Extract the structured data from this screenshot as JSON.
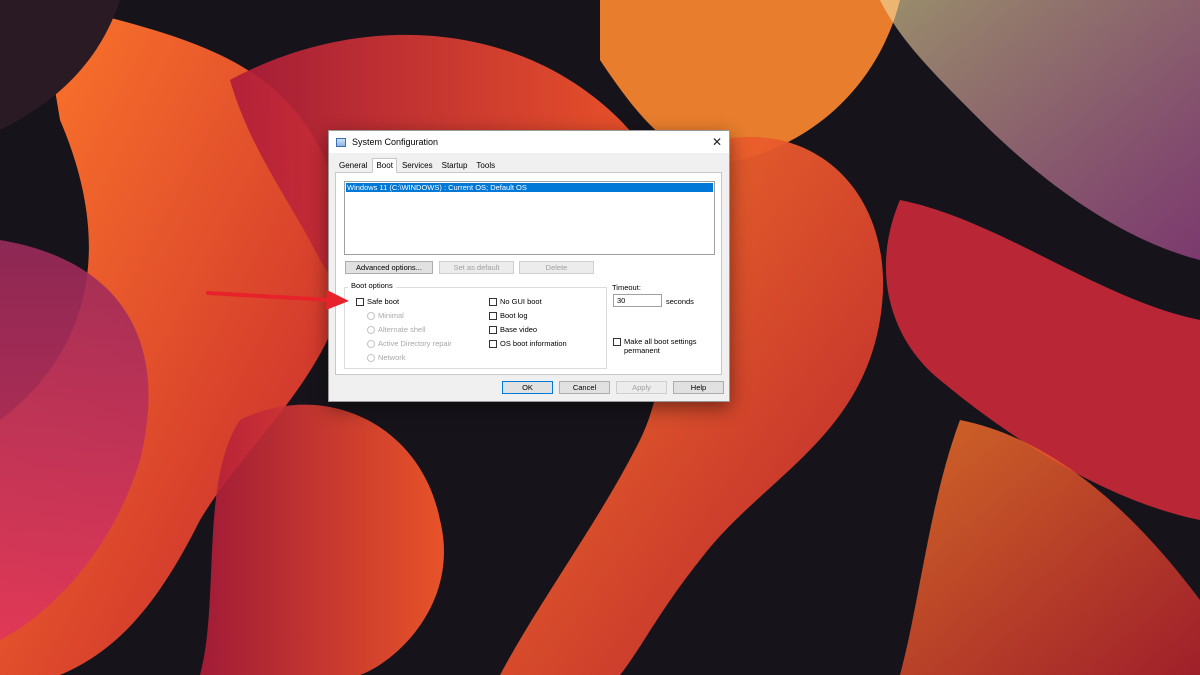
{
  "dialog": {
    "title": "System Configuration",
    "close_glyph": "✕",
    "icon": "system-config-icon"
  },
  "tabs": [
    {
      "label": "General",
      "active": false
    },
    {
      "label": "Boot",
      "active": true
    },
    {
      "label": "Services",
      "active": false
    },
    {
      "label": "Startup",
      "active": false
    },
    {
      "label": "Tools",
      "active": false
    }
  ],
  "boot": {
    "os_entries": [
      "Windows 11 (C:\\WINDOWS) : Current OS; Default OS"
    ],
    "advanced_label": "Advanced options...",
    "set_default_label": "Set as default",
    "delete_label": "Delete",
    "boot_options_label": "Boot options",
    "safe_boot_label": "Safe boot",
    "safe_boot_checked": false,
    "minimal_label": "Minimal",
    "alternate_shell_label": "Alternate shell",
    "active_directory_label": "Active Directory repair",
    "network_label": "Network",
    "no_gui_label": "No GUI boot",
    "boot_log_label": "Boot log",
    "base_video_label": "Base video",
    "os_boot_info_label": "OS boot information",
    "timeout_label": "Timeout:",
    "timeout_value": "30",
    "seconds_label": "seconds",
    "permanent_line1": "Make all boot settings",
    "permanent_line2": "permanent"
  },
  "footer": {
    "ok_label": "OK",
    "cancel_label": "Cancel",
    "apply_label": "Apply",
    "help_label": "Help"
  },
  "colors": {
    "selection": "#0078d7",
    "arrow": "#e8222a"
  }
}
